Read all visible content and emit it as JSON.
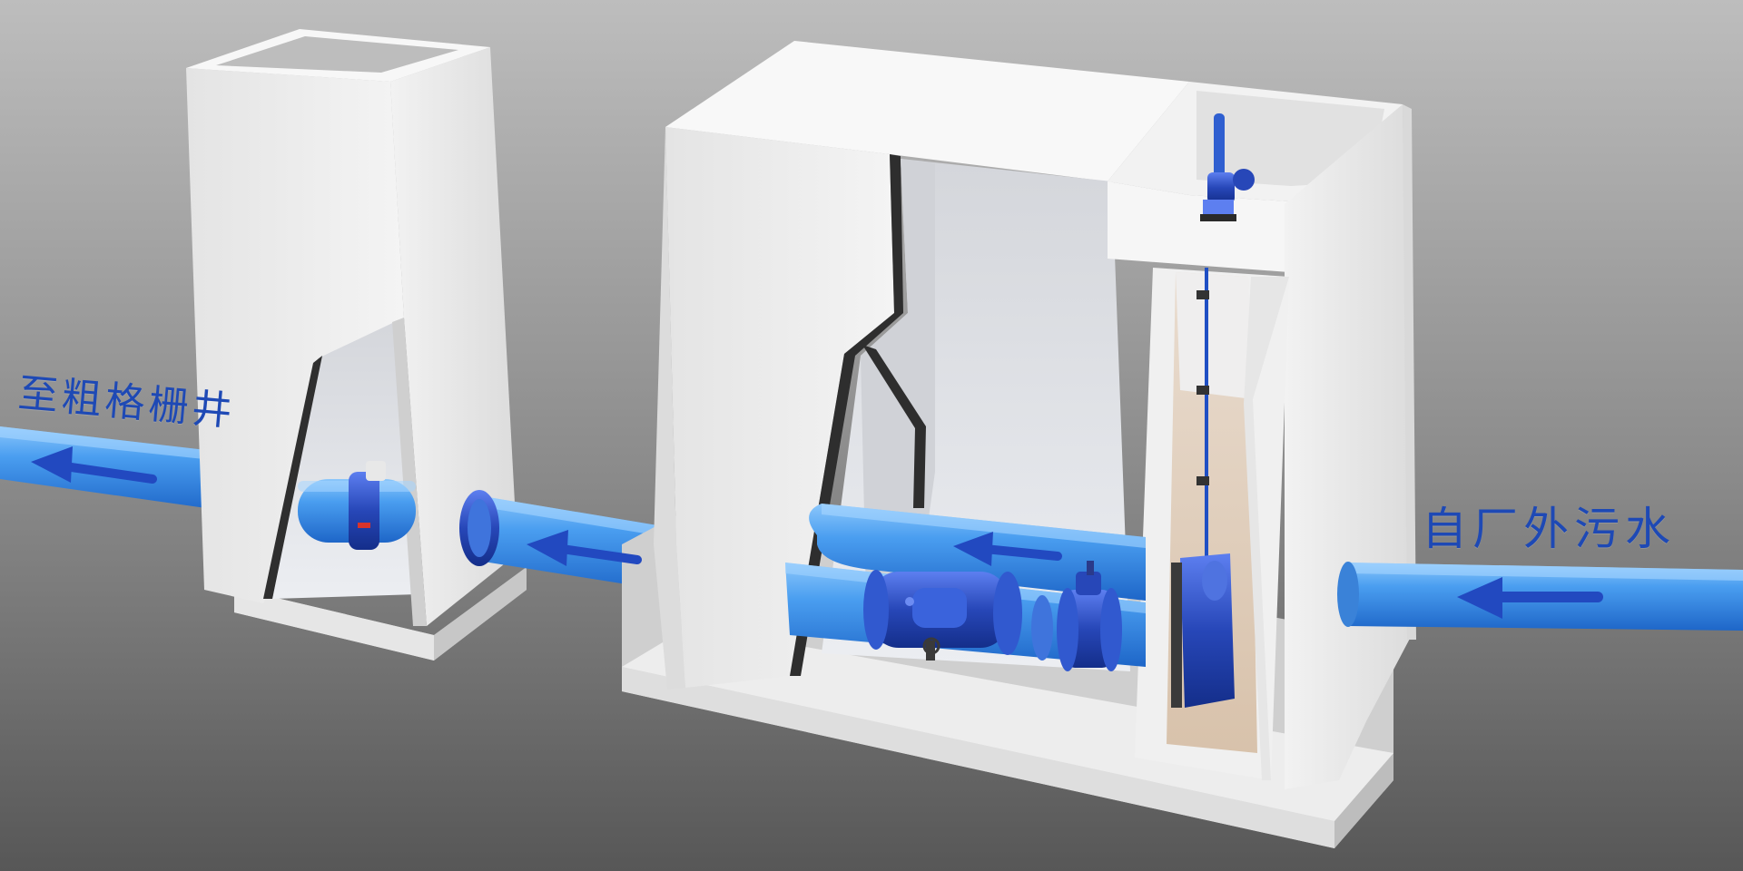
{
  "labels": {
    "outlet": "至粗格栅井",
    "inlet": "自厂外污水"
  },
  "colors": {
    "background_top": "#b9b9b9",
    "background_bottom": "#5a5a5a",
    "pipe": "#3d8fe0",
    "pipe_light": "#6ab4f5",
    "pipe_dark": "#1f63c2",
    "valve": "#2347b8",
    "arrow": "#1f4fc4",
    "concrete": "#e9e9e9",
    "label": "#1e49b5"
  },
  "icons": {
    "flow_arrow": "flow-arrow-icon"
  }
}
